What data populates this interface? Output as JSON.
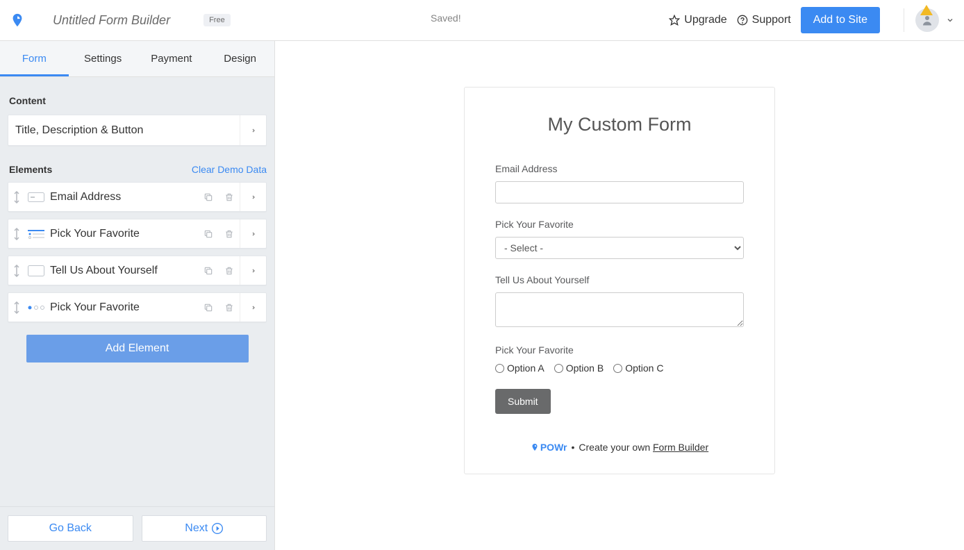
{
  "header": {
    "app_title": "Untitled Form Builder",
    "badge": "Free",
    "saved": "Saved!",
    "upgrade": "Upgrade",
    "support": "Support",
    "add_to_site": "Add to Site"
  },
  "sidebar": {
    "tabs": [
      "Form",
      "Settings",
      "Payment",
      "Design"
    ],
    "active_tab": 0,
    "content_section": "Content",
    "title_card": "Title, Description & Button",
    "elements_section": "Elements",
    "clear_demo": "Clear Demo Data",
    "elements": [
      {
        "label": "Email Address",
        "type": "text"
      },
      {
        "label": "Pick Your Favorite",
        "type": "select"
      },
      {
        "label": "Tell Us About Yourself",
        "type": "textarea"
      },
      {
        "label": "Pick Your Favorite",
        "type": "radio"
      }
    ],
    "add_element": "Add Element",
    "go_back": "Go Back",
    "next": "Next"
  },
  "form": {
    "title": "My Custom Form",
    "fields": {
      "email_label": "Email Address",
      "fav_label": "Pick Your Favorite",
      "fav_placeholder": "- Select -",
      "about_label": "Tell Us About Yourself",
      "fav2_label": "Pick Your Favorite",
      "options": [
        "Option A",
        "Option B",
        "Option C"
      ]
    },
    "submit": "Submit",
    "brand_name": "POWr",
    "brand_dot": "•",
    "brand_text": "Create your own ",
    "brand_link": "Form Builder"
  }
}
